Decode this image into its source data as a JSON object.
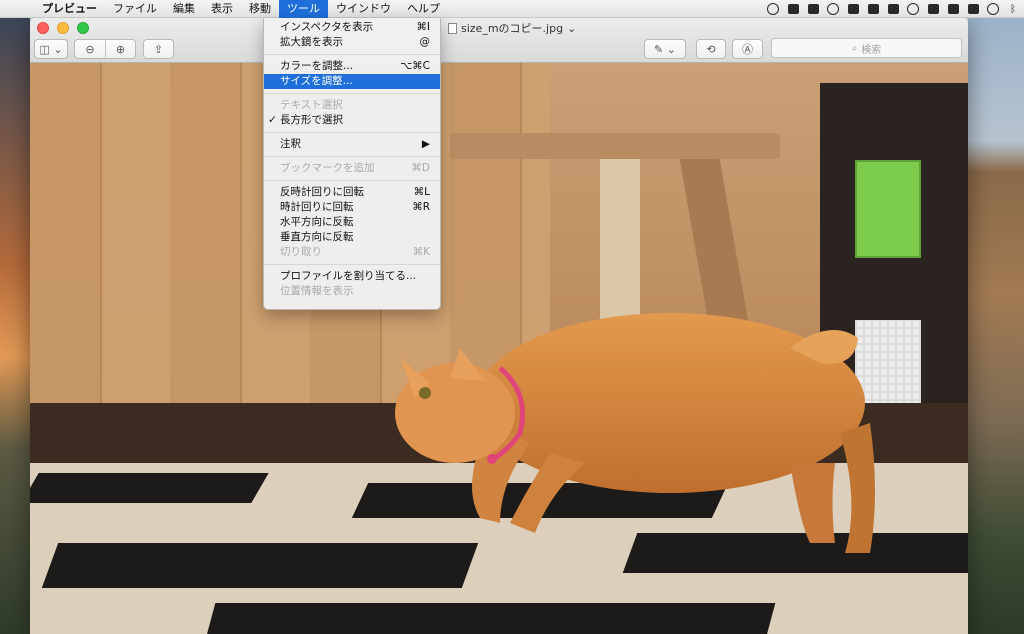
{
  "menubar": {
    "apple": "",
    "items": [
      {
        "label": "プレビュー"
      },
      {
        "label": "ファイル"
      },
      {
        "label": "編集"
      },
      {
        "label": "表示"
      },
      {
        "label": "移動"
      },
      {
        "label": "ツール"
      },
      {
        "label": "ウインドウ"
      },
      {
        "label": "ヘルプ"
      }
    ]
  },
  "window": {
    "title": "size_mのコピー.jpg",
    "title_chevron": "⌄",
    "search_placeholder": "検索",
    "toolbar": {
      "sidebar_label": "◫ ⌄",
      "zoom_out": "⊖",
      "zoom_in": "⊕",
      "share": "⇪",
      "markup": "✎ ⌄",
      "rotate": "⟲",
      "annotate": "Ⓐ"
    }
  },
  "tools_menu": {
    "items": [
      {
        "label": "インスペクタを表示",
        "shortcut": "⌘I"
      },
      {
        "label": "拡大鏡を表示",
        "shortcut": "@"
      },
      {
        "label": "カラーを調整...",
        "shortcut": "⌥⌘C"
      },
      {
        "label": "サイズを調整...",
        "shortcut": ""
      },
      {
        "label": "テキスト選択",
        "shortcut": ""
      },
      {
        "label": "長方形で選択",
        "shortcut": "",
        "check": "✓"
      },
      {
        "label": "注釈",
        "shortcut": "▶"
      },
      {
        "label": "ブックマークを追加",
        "shortcut": "⌘D"
      },
      {
        "label": "反時計回りに回転",
        "shortcut": "⌘L"
      },
      {
        "label": "時計回りに回転",
        "shortcut": "⌘R"
      },
      {
        "label": "水平方向に反転",
        "shortcut": ""
      },
      {
        "label": "垂直方向に反転",
        "shortcut": ""
      },
      {
        "label": "切り取り",
        "shortcut": "⌘K"
      },
      {
        "label": "プロファイルを割り当てる...",
        "shortcut": ""
      },
      {
        "label": "位置情報を表示",
        "shortcut": ""
      }
    ]
  },
  "colors": {
    "selection": "#1e6fd9",
    "disabled_text": "#a9a9a9"
  }
}
